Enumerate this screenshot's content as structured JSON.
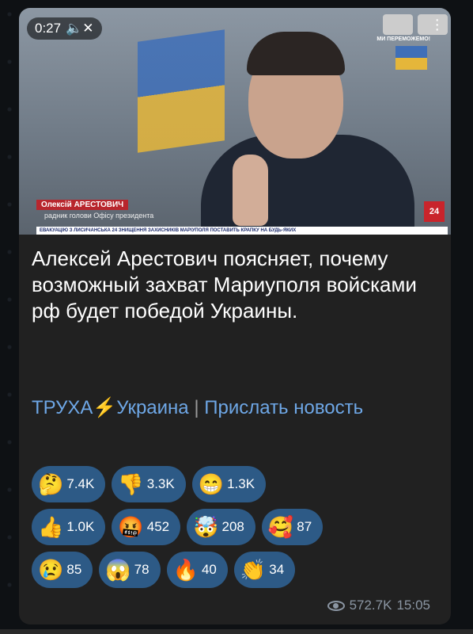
{
  "video": {
    "duration": "0:27",
    "mute_icon": "speaker-muted-icon",
    "lower_third_name": "Олексій АРЕСТОВИЧ",
    "lower_third_role": "радник голови Офісу президента",
    "ticker": "ЕВАКУАЦІЮ З ЛИСИЧАНСЬКА  24  ЗНИЩЕННЯ ЗАХИСНИКІВ МАРІУПОЛЯ ПОСТАВИТЬ КРАПКУ НА БУДЬ-ЯКИХ",
    "banner": "МИ ПЕРЕМОЖЕМО!",
    "channel_logo": "24"
  },
  "caption": "Алексей Арестович поясняет, почему возможный захват Мариуполя войсками рф будет победой Украины.",
  "links": {
    "channel": "ТРУХА⚡Украина",
    "separator": "|",
    "send_news": "Прислать новость"
  },
  "reactions": [
    [
      {
        "emoji": "🤔",
        "count": "7.4K"
      },
      {
        "emoji": "👎",
        "count": "3.3K"
      },
      {
        "emoji": "😁",
        "count": "1.3K"
      }
    ],
    [
      {
        "emoji": "👍",
        "count": "1.0K"
      },
      {
        "emoji": "🤬",
        "count": "452"
      },
      {
        "emoji": "🤯",
        "count": "208"
      },
      {
        "emoji": "🥰",
        "count": "87"
      }
    ],
    [
      {
        "emoji": "😢",
        "count": "85"
      },
      {
        "emoji": "😱",
        "count": "78"
      },
      {
        "emoji": "🔥",
        "count": "40"
      },
      {
        "emoji": "👏",
        "count": "34"
      }
    ]
  ],
  "meta": {
    "views": "572.7K",
    "time": "15:05"
  },
  "colors": {
    "bubble": "#212121",
    "link": "#6ea7e6",
    "reaction_chip": "#2d5a86"
  }
}
